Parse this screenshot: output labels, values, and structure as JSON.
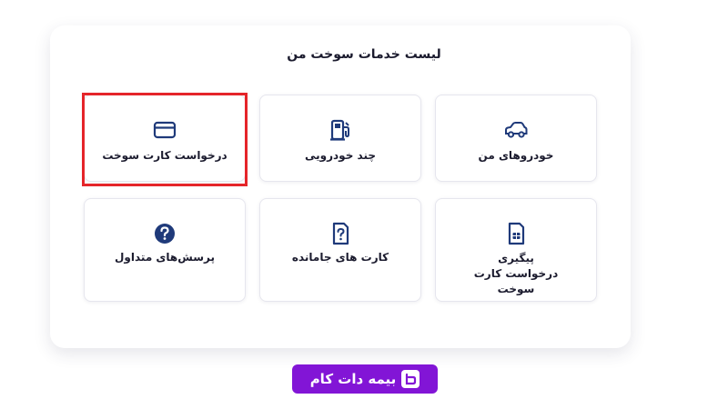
{
  "page": {
    "title": "لیست خدمات سوخت من"
  },
  "cards": [
    {
      "label": "درخواست کارت سوخت",
      "icon": "credit-card-icon"
    },
    {
      "label": "چند خودرویی",
      "icon": "fuel-pump-icon"
    },
    {
      "label": "خودروهای من",
      "icon": "car-icon"
    },
    {
      "label": "پرسش‌های متداول",
      "icon": "question-circle-icon"
    },
    {
      "label": "کارت های جامانده",
      "icon": "question-card-icon"
    },
    {
      "label": "پیگیری درخواست کارت سوخت",
      "icon": "sim-card-icon"
    }
  ],
  "highlight": {
    "color": "#e5252a",
    "target": "درخواست کارت سوخت"
  },
  "watermark": {
    "text": "بیمه دات کام",
    "color": "#8215d6"
  },
  "colors": {
    "icon": "#1f3a7a",
    "text": "#1b1b2e"
  }
}
